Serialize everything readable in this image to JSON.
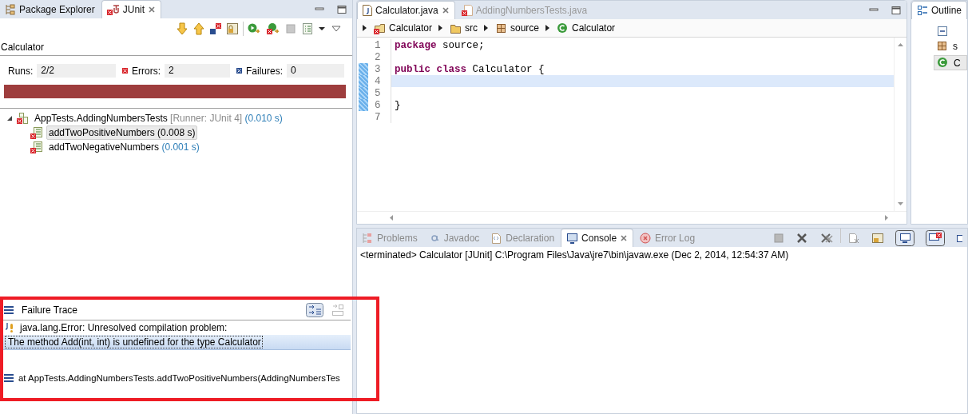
{
  "junit_view": {
    "tabs": [
      {
        "label": "Package Explorer",
        "selected": false,
        "closable": false
      },
      {
        "label": "JUnit",
        "selected": true,
        "closable": true
      }
    ],
    "run_name": "Calculator",
    "counters": [
      {
        "label": "Runs:",
        "value": "2/2",
        "kind": "runs"
      },
      {
        "label": "Errors:",
        "value": "2",
        "kind": "errors"
      },
      {
        "label": "Failures:",
        "value": "0",
        "kind": "failures"
      }
    ],
    "progress": {
      "level": 1,
      "failed": true
    },
    "tree": [
      {
        "label": "AppTests.AddingNumbersTests",
        "runner": "[Runner: JUnit 4]",
        "time": "(0.010 s)",
        "expanded": true,
        "selected": false,
        "children": [
          {
            "label": "addTwoPositiveNumbers",
            "time": "(0.008 s)",
            "selected": true
          },
          {
            "label": "addTwoNegativeNumbers",
            "time": "(0.001 s)",
            "selected": false
          }
        ]
      }
    ],
    "failure_trace": {
      "title": "Failure Trace",
      "lines": [
        {
          "kind": "error",
          "text": "java.lang.Error: Unresolved compilation problem:",
          "selected": false
        },
        {
          "kind": "message",
          "text": "The method Add(int, int) is undefined for the type Calculator",
          "selected": true
        },
        {
          "kind": "blank",
          "selected": false
        },
        {
          "kind": "frame",
          "text": "at AppTests.AddingNumbersTests.addTwoPositiveNumbers(AddingNumbersTes",
          "selected": false
        }
      ]
    }
  },
  "editor": {
    "tabs": [
      {
        "label": "Calculator.java",
        "selected": true,
        "closable": true
      },
      {
        "label": "AddingNumbersTests.java",
        "selected": false,
        "closable": false
      }
    ],
    "breadcrumb": [
      {
        "label": "Calculator",
        "kind": "project"
      },
      {
        "label": "src",
        "kind": "folder"
      },
      {
        "label": "source",
        "kind": "package"
      },
      {
        "label": "Calculator",
        "kind": "class"
      }
    ],
    "lines": [
      {
        "number": "1",
        "changed": false,
        "current": false,
        "code": [
          {
            "kind": "keyword",
            "text": "package"
          },
          {
            "kind": "plain",
            "text": " source;"
          }
        ]
      },
      {
        "number": "2",
        "changed": false,
        "current": false
      },
      {
        "number": "3",
        "changed": true,
        "current": false,
        "code": [
          {
            "kind": "keyword",
            "text": "public class"
          },
          {
            "kind": "plain",
            "text": " Calculator {"
          }
        ]
      },
      {
        "number": "4",
        "changed": true,
        "current": true
      },
      {
        "number": "5",
        "changed": true,
        "current": false
      },
      {
        "number": "6",
        "changed": true,
        "current": false,
        "code": [
          {
            "kind": "plain",
            "text": "}"
          }
        ]
      },
      {
        "number": "7",
        "changed": false,
        "current": false
      }
    ]
  },
  "console_view": {
    "tabs": [
      {
        "label": "Problems",
        "selected": false,
        "closable": false
      },
      {
        "label": "Javadoc",
        "selected": false,
        "closable": false
      },
      {
        "label": "Declaration",
        "selected": false,
        "closable": false
      },
      {
        "label": "Console",
        "selected": true,
        "closable": true
      },
      {
        "label": "Error Log",
        "selected": false,
        "closable": false
      }
    ],
    "status": "<terminated> Calculator [JUnit] C:\\Program Files\\Java\\jre7\\bin\\javaw.exe (Dec 2, 2014, 12:54:37 AM)"
  },
  "outline": {
    "title": "Outline",
    "items": [
      {
        "label": "s",
        "kind": "package"
      },
      {
        "label": "C",
        "kind": "class",
        "selected": true
      }
    ]
  }
}
